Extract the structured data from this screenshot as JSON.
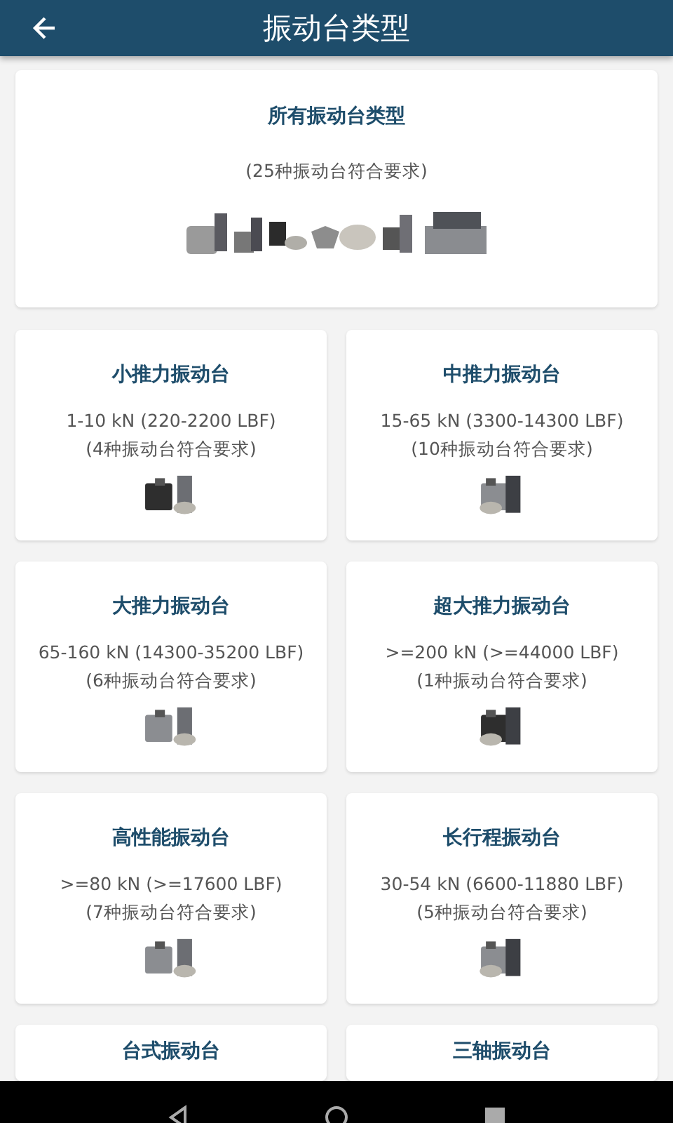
{
  "app_bar": {
    "title": "振动台类型"
  },
  "all_types": {
    "title": "所有振动台类型",
    "count": "(25种振动台符合要求)"
  },
  "cards": [
    {
      "title": "小推力振动台",
      "range": "1-10 kN (220-2200 LBF)",
      "count": "(4种振动台符合要求)"
    },
    {
      "title": "中推力振动台",
      "range": "15-65 kN (3300-14300 LBF)",
      "count": "(10种振动台符合要求)"
    },
    {
      "title": "大推力振动台",
      "range": "65-160 kN (14300-35200 LBF)",
      "count": "(6种振动台符合要求)"
    },
    {
      "title": "超大推力振动台",
      "range": ">=200 kN (>=44000 LBF)",
      "count": "(1种振动台符合要求)"
    },
    {
      "title": "高性能振动台",
      "range": ">=80 kN (>=17600 LBF)",
      "count": "(7种振动台符合要求)"
    },
    {
      "title": "长行程振动台",
      "range": "30-54 kN (6600-11880 LBF)",
      "count": "(5种振动台符合要求)"
    },
    {
      "title": "台式振动台"
    },
    {
      "title": "三轴振动台"
    }
  ]
}
